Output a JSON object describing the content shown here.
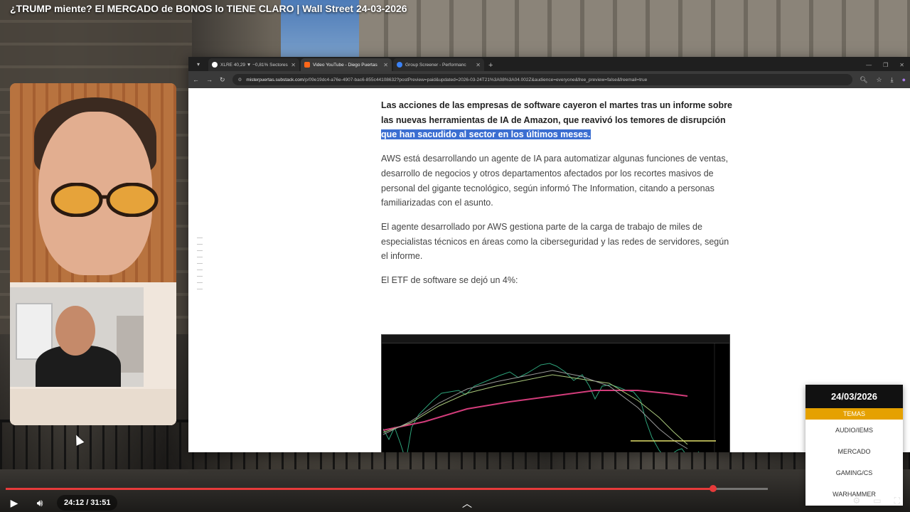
{
  "video": {
    "title": "¿TRUMP miente? El MERCADO de BONOS lo TIENE CLARO | Wall Street 24-03-2026",
    "current_time": "24:12",
    "duration": "31:51",
    "time_display": "24:12 / 31:51",
    "progress_fraction": 0.928,
    "accent_color": "#e63a3a"
  },
  "browser": {
    "tabs": [
      {
        "label": "XLRE 40,29 ▼ −0,81% Sectores",
        "active": false
      },
      {
        "label": "Video YouTube - Diego Puertas",
        "active": true
      },
      {
        "label": "Group Screener - Performanc",
        "active": false
      }
    ],
    "url_host": "misterpuertas.substack.com",
    "url_path": "/p/09e19dc4-a76e-4907-bac6-855c44108632?postPreview=paid&updated=2026-03-24T21%3A08%3A04.002Z&audience=everyone&free_preview=false&freemail=true"
  },
  "article": {
    "lead_plain": "Las acciones de las empresas de software cayeron el martes tras un informe sobre las nuevas herramientas de IA de Amazon, que reavivó los temores de disrupción ",
    "lead_highlight": "que han sacudido al sector en los últimos meses.",
    "p1": "AWS está desarrollando un agente de IA para automatizar algunas funciones de ventas, desarrollo de negocios y otros departamentos afectados por los recortes masivos de personal del gigante tecnológico, según informó The Information, citando a personas familiarizadas con el asunto.",
    "p2": "El agente desarrollado por AWS gestiona parte de la carga de trabajo de miles de especialistas técnicos en áreas como la ciberseguridad y las redes de servidores, según el informe.",
    "p3": "El ETF de software se dejó un 4%:"
  },
  "topics_card": {
    "date": "24/03/2026",
    "header": "TEMAS",
    "items": [
      "AUDIO/IEMS",
      "MERCADO",
      "GAMING/CS",
      "WARHAMMER"
    ],
    "header_color": "#e5a100"
  },
  "icons": {
    "play": "play-icon",
    "volume": "volume-icon",
    "chevron": "chevron-up-icon"
  }
}
